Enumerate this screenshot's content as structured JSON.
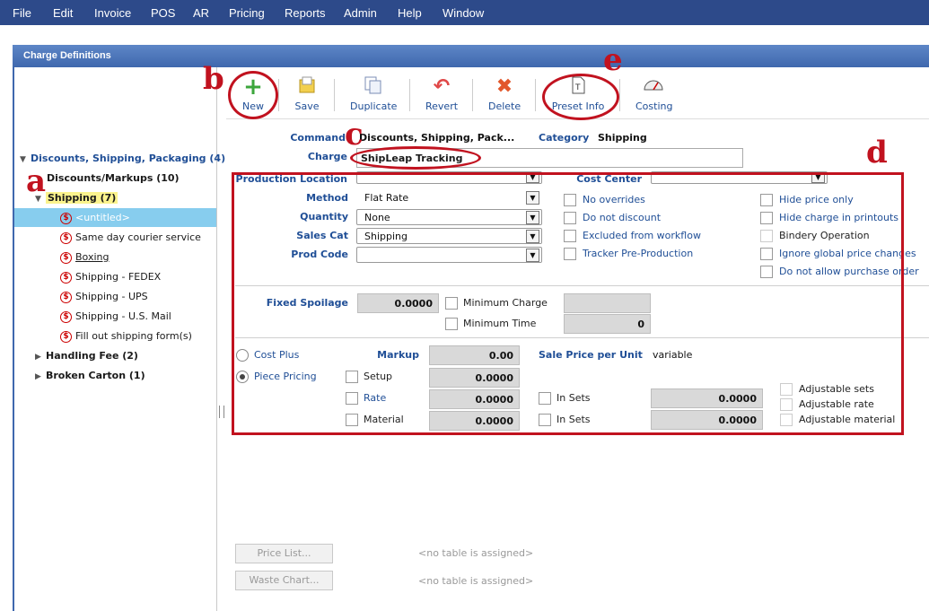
{
  "menu": [
    "File",
    "Edit",
    "Invoice",
    "POS",
    "AR",
    "Pricing",
    "Reports",
    "Admin",
    "Help",
    "Window"
  ],
  "panel_title": "Charge Definitions",
  "tree": {
    "root": "Discounts, Shipping, Packaging (4)",
    "discounts": "Discounts/Markups (10)",
    "shipping": "Shipping (7)",
    "shipping_children": [
      "<untitled>",
      "Same day courier service",
      "Boxing",
      "Shipping - FEDEX",
      "Shipping - UPS",
      "Shipping - U.S. Mail",
      "Fill out shipping form(s)"
    ],
    "handling": "Handling Fee (2)",
    "broken": "Broken Carton (1)"
  },
  "toolbar": {
    "new": "New",
    "save": "Save",
    "duplicate": "Duplicate",
    "revert": "Revert",
    "delete": "Delete",
    "preset": "Preset Info",
    "costing": "Costing"
  },
  "header": {
    "command_label": "Command",
    "command_value": "Discounts, Shipping, Pack...",
    "category_label": "Category",
    "category_value": "Shipping",
    "charge_label": "Charge",
    "charge_value": "ShipLeap Tracking"
  },
  "fields": {
    "production_location": "Production Location",
    "cost_center": "Cost Center",
    "method": "Method",
    "method_value": "Flat Rate",
    "quantity": "Quantity",
    "quantity_value": "None",
    "sales_cat": "Sales Cat",
    "sales_cat_value": "Shipping",
    "prod_code": "Prod Code"
  },
  "checks_mid": [
    "No overrides",
    "Do not discount",
    "Excluded from workflow",
    "Tracker Pre-Production"
  ],
  "checks_right": [
    "Hide price only",
    "Hide charge in printouts",
    "Bindery Operation",
    "Ignore global price changes",
    "Do not allow purchase order"
  ],
  "spoilage": {
    "label": "Fixed Spoilage",
    "value": "0.0000",
    "min_charge": "Minimum Charge",
    "min_time": "Minimum Time",
    "min_time_value": "0"
  },
  "pricing": {
    "cost_plus": "Cost Plus",
    "markup": "Markup",
    "markup_value": "0.00",
    "sale_price_label": "Sale Price per Unit",
    "sale_price_value": "variable",
    "piece_pricing": "Piece Pricing",
    "setup": "Setup",
    "setup_value": "0.0000",
    "rate": "Rate",
    "rate_value": "0.0000",
    "material": "Material",
    "material_value": "0.0000",
    "in_sets": "In Sets",
    "in_sets_rate": "0.0000",
    "in_sets_material": "0.0000",
    "adjustable_sets": "Adjustable sets",
    "adjustable_rate": "Adjustable rate",
    "adjustable_material": "Adjustable material"
  },
  "bottom": {
    "price_list": "Price List...",
    "waste_chart": "Waste Chart...",
    "no_table": "<no table is assigned>"
  },
  "annotations": [
    "a",
    "b",
    "c",
    "d",
    "e"
  ],
  "colors": {
    "menubar": "#2d4a8a",
    "header": "#4a74b9",
    "label_blue": "#1f4e96",
    "annotation_red": "#c1121f",
    "selected": "#87cdee"
  }
}
